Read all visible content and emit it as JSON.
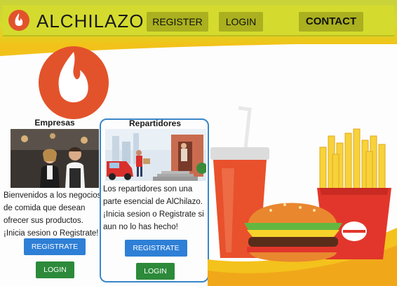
{
  "header": {
    "brand": "ALCHILAZO",
    "nav": {
      "register": "REGISTER",
      "login": "LOGIN",
      "contact": "CONTACT"
    }
  },
  "sections": {
    "empresas": {
      "title": "Empresas",
      "description": "Bienvenidos a los negocios de comida que desean ofrecer sus productos. ¡Inicia sesion o Registrate!",
      "register_label": "REGISTRATE",
      "login_label": "LOGIN"
    },
    "repartidores": {
      "title": "Repartidores",
      "description": "Los repartidores son una parte esencial de AlChilazo. ¡Inicia sesion o Registrate si aun no lo has hecho!",
      "register_label": "REGISTRATE",
      "login_label": "LOGIN"
    }
  },
  "colors": {
    "header_yellow": "#d4db2e",
    "nav_button": "#aab01f",
    "brand_red": "#e2532b",
    "primary_blue": "#2e7fd6",
    "login_green": "#2c8a3a",
    "card_border": "#3b87c9"
  },
  "icons": [
    "flame-logo-icon",
    "burger-illustration",
    "fries-illustration",
    "soda-cup-illustration"
  ]
}
